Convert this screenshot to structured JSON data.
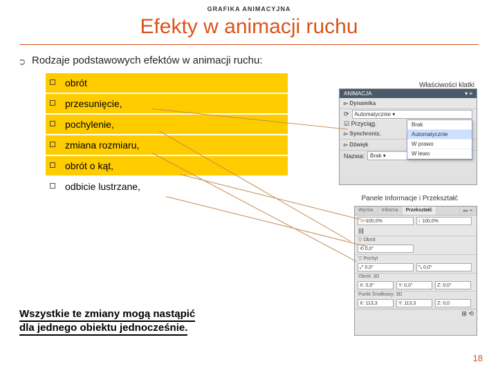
{
  "header_small": "GRAFIKA ANIMACYJNA",
  "title": "Efekty w animacji ruchu",
  "lead": "Rodzaje podstawowych efektów w animacji ruchu:",
  "label_top": "Właściwości klatki",
  "label_mid": "Panele Informacje i Przekształć",
  "list": {
    "i0": "obrót",
    "i1": "przesunięcie,",
    "i2": "pochylenie,",
    "i3": "zmiana rozmiaru,",
    "i4": "obrót  o kąt,",
    "i5": "odbicie lustrzane,"
  },
  "panel1": {
    "tab": "ANIMACJA",
    "sec1": "▻ Dynamika",
    "dd1": "Automatycznie ▾",
    "row_chk": "☑ Przyciąg.",
    "sec2": "▻ Synchroniz.",
    "sec3": "▻ Dźwięk",
    "lbl_name": "Nazwa:",
    "dd2": "Brak ▾",
    "menu": {
      "m0": "Brak",
      "m1": "Automatycznie",
      "m2": "W prawo",
      "m3": "W lewo"
    }
  },
  "panel2": {
    "tab0": "Wyrów.",
    "tab1": "Informa",
    "tab2": "Przekształć",
    "s1a": "↔ 100,0%",
    "s1b": "↕ 100,0%",
    "sec_obrot": "▽ Obrót",
    "rot": "⟲ 0,0°",
    "sec_pochyl": "▽ Pochyl",
    "p1": "⤢ 0,0°",
    "p2": "⤡ 0,0°",
    "sec_3d": "Obrót: 3D",
    "r3x": "X: 0,0°",
    "r3y": "Y: 0,0°",
    "r3z": "Z: 0,0°",
    "sec_pt3d": "Punkt Środkowy: 3D",
    "cx": "X: 113,3",
    "cy": "Y: 113,3",
    "cz": "Z: 0,0"
  },
  "conclusion_l1": "Wszystkie te zmiany mogą nastąpić",
  "conclusion_l2": "dla jednego obiektu jednocześnie.",
  "pagenum": "18"
}
